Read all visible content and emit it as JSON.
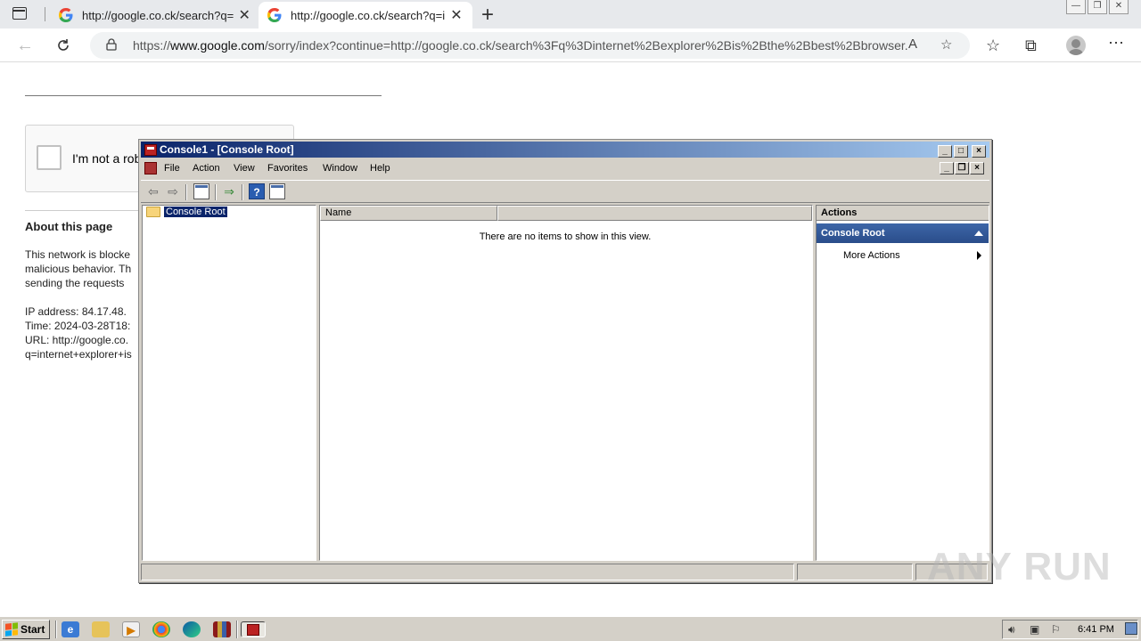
{
  "browser": {
    "tabs": [
      {
        "title": "http://google.co.ck/search?q=i",
        "close": "✕"
      },
      {
        "title": "http://google.co.ck/search?q=i",
        "close": "✕"
      }
    ],
    "new_tab": "+",
    "url_prefix": "https://",
    "url_host": "www.google.com",
    "url_rest": "/sorry/index?continue=http://google.co.ck/search%3Fq%3Dinternet%2Bexplorer%2Bis%2Bthe%2Bbest%2Bbrowser...",
    "window_buttons": [
      "—",
      "❐",
      "✕"
    ]
  },
  "page": {
    "captcha_label": "I'm not a robot",
    "about_heading": "About this page",
    "paragraph_lines": [
      "This network is blocke",
      "malicious behavior. Th",
      "sending the requests"
    ],
    "info_lines": [
      "IP address: 84.17.48.",
      "Time: 2024-03-28T18:",
      "URL: http://google.co.",
      "q=internet+explorer+is"
    ]
  },
  "mmc": {
    "title": "Console1 - [Console Root]",
    "menu": [
      "File",
      "Action",
      "View",
      "Favorites",
      "Window",
      "Help"
    ],
    "tree_root": "Console Root",
    "column_name": "Name",
    "empty_message": "There are no items to show in this view.",
    "actions_header": "Actions",
    "actions_section": "Console Root",
    "actions_item": "More Actions"
  },
  "watermark": "ANY RUN",
  "taskbar": {
    "start_label": "Start",
    "clock": "6:41 PM"
  },
  "colors": {
    "titlebar_start": "#0a246a",
    "titlebar_end": "#a6caf0",
    "actions_section": "#2a4d8a"
  }
}
